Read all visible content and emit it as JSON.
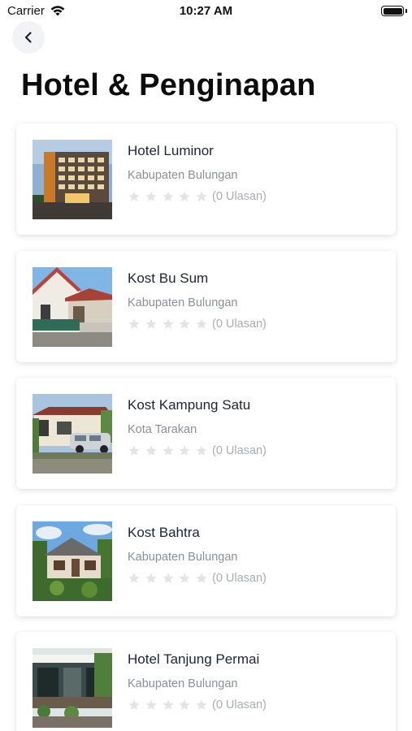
{
  "status_bar": {
    "carrier": "Carrier",
    "time": "10:27 AM"
  },
  "header": {
    "back_icon": "chevron-left-icon",
    "title": "Hotel & Penginapan"
  },
  "colors": {
    "star_empty": "#e2e4e8",
    "location_text": "#8a8f98",
    "review_text": "#a9adb4"
  },
  "listings": [
    {
      "name": "Hotel Luminor",
      "location": "Kabupaten Bulungan",
      "rating": 0,
      "reviews": "(0 Ulasan)"
    },
    {
      "name": "Kost Bu Sum",
      "location": "Kabupaten Bulungan",
      "rating": 0,
      "reviews": "(0 Ulasan)"
    },
    {
      "name": "Kost Kampung Satu",
      "location": "Kota Tarakan",
      "rating": 0,
      "reviews": "(0 Ulasan)"
    },
    {
      "name": "Kost Bahtra",
      "location": "Kabupaten Bulungan",
      "rating": 0,
      "reviews": "(0 Ulasan)"
    },
    {
      "name": "Hotel Tanjung Permai",
      "location": "Kabupaten Bulungan",
      "rating": 0,
      "reviews": "(0 Ulasan)"
    }
  ]
}
